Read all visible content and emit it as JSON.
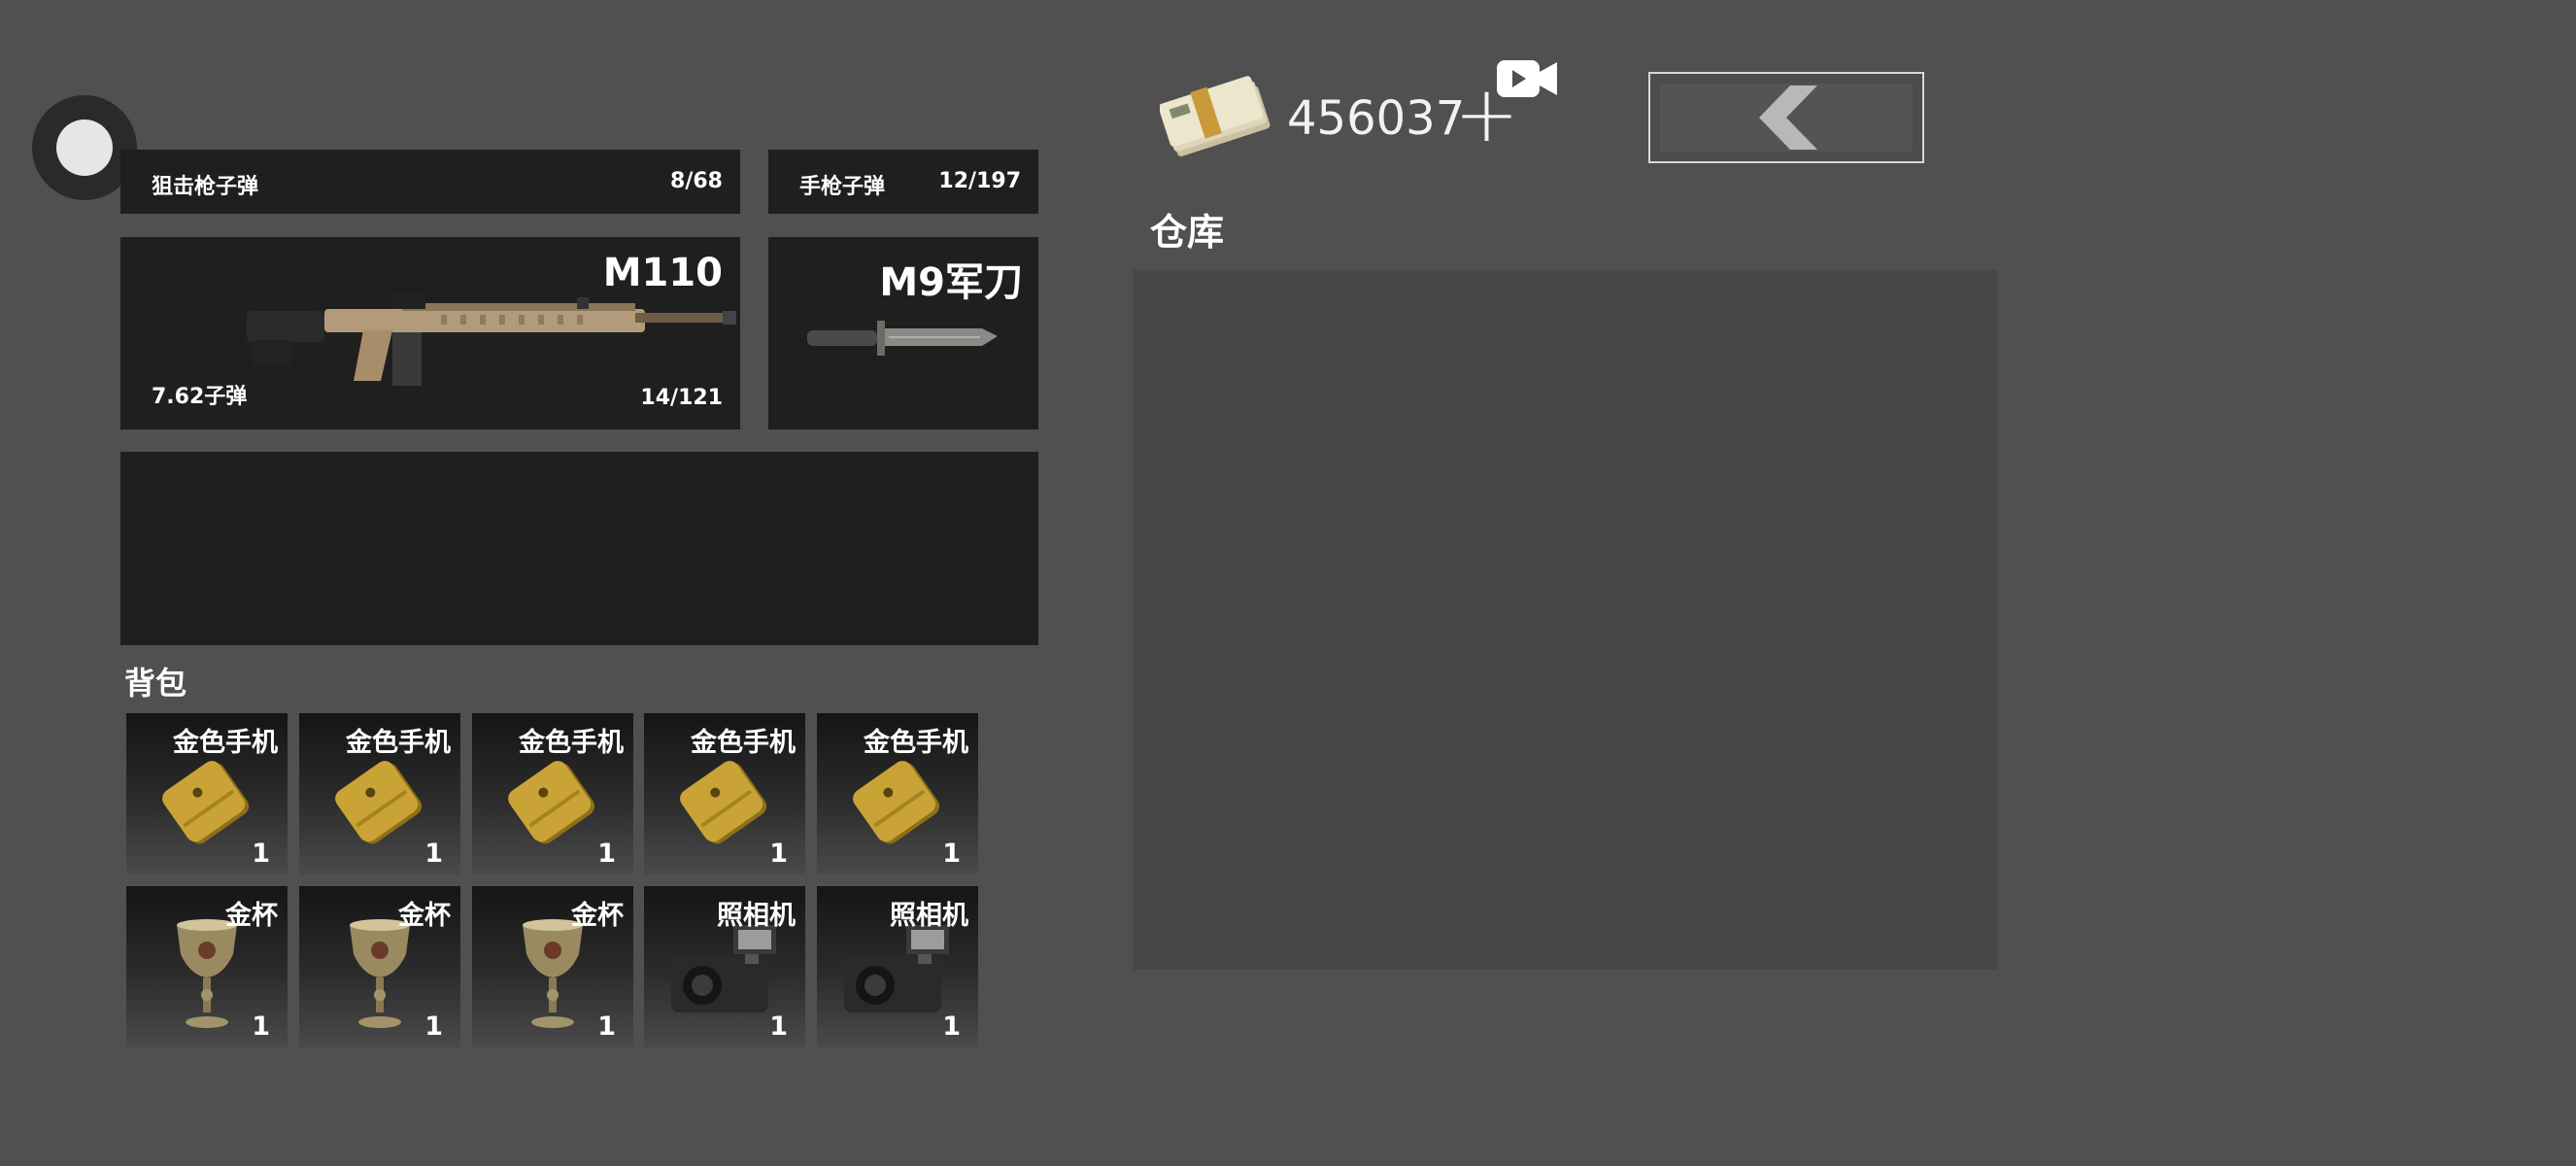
{
  "topbar": {
    "money": "456037",
    "plus_symbol": "+",
    "back_icon": "chevron-left-icon",
    "video_icon": "video-camera-icon",
    "settings_icon": "circle-toggle-icon"
  },
  "ammo": {
    "sniper": {
      "label": "狙击枪子弹",
      "count": "8/68"
    },
    "pistol": {
      "label": "手枪子弹",
      "count": "12/197"
    }
  },
  "primary_weapon": {
    "name": "M110",
    "ammo_label": "7.62子弹",
    "ammo_count": "14/121",
    "icon": "rifle-icon"
  },
  "melee_weapon": {
    "name": "M9军刀",
    "icon": "knife-icon"
  },
  "backpack": {
    "title": "背包",
    "items": [
      {
        "name": "金色手机",
        "count": "1",
        "icon": "gold-phone-icon"
      },
      {
        "name": "金色手机",
        "count": "1",
        "icon": "gold-phone-icon"
      },
      {
        "name": "金色手机",
        "count": "1",
        "icon": "gold-phone-icon"
      },
      {
        "name": "金色手机",
        "count": "1",
        "icon": "gold-phone-icon"
      },
      {
        "name": "金色手机",
        "count": "1",
        "icon": "gold-phone-icon"
      },
      {
        "name": "金杯",
        "count": "1",
        "icon": "gold-cup-icon"
      },
      {
        "name": "金杯",
        "count": "1",
        "icon": "gold-cup-icon"
      },
      {
        "name": "金杯",
        "count": "1",
        "icon": "gold-cup-icon"
      },
      {
        "name": "照相机",
        "count": "1",
        "icon": "camera-icon"
      },
      {
        "name": "照相机",
        "count": "1",
        "icon": "camera-icon"
      }
    ]
  },
  "warehouse": {
    "title": "仓库"
  }
}
